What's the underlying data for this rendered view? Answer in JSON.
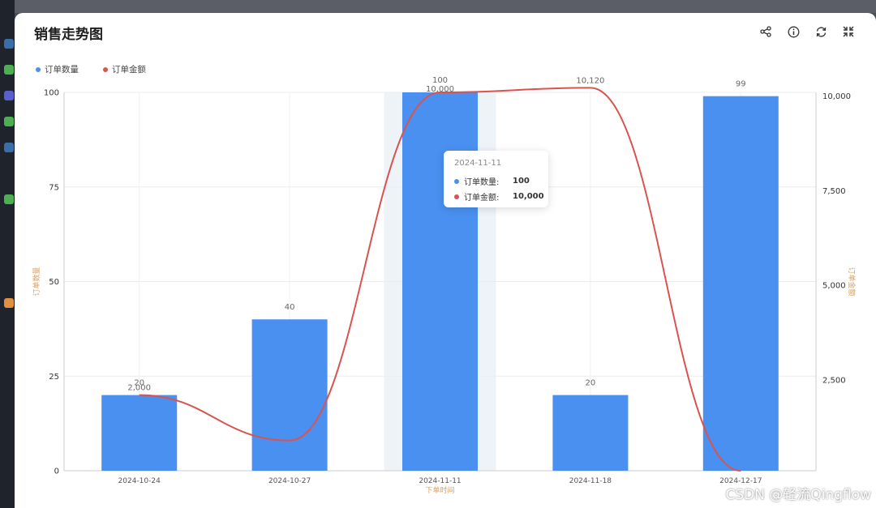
{
  "panel": {
    "title": "销售走势图"
  },
  "toolbar": [
    {
      "icon": "share-icon"
    },
    {
      "icon": "info-icon"
    },
    {
      "icon": "refresh-icon"
    },
    {
      "icon": "collapse-icon"
    }
  ],
  "colors": {
    "bar": "#4a90f0",
    "line": "#d9534f",
    "axis_title": "#e0a060",
    "highlight": "#eef3f8"
  },
  "legend": [
    {
      "label": "订单数量",
      "color": "#4a90f0"
    },
    {
      "label": "订单金额",
      "color": "#d9534f"
    }
  ],
  "chart_data": {
    "type": "bar",
    "categories": [
      "2024-10-24",
      "2024-10-27",
      "2024-11-11",
      "2024-11-18",
      "2024-12-17"
    ],
    "series": [
      {
        "name": "订单数量",
        "type": "bar",
        "axis": "left",
        "values": [
          20,
          40,
          100,
          20,
          99
        ],
        "labels": [
          "20",
          "40",
          "100",
          "20",
          "99"
        ]
      },
      {
        "name": "订单金额",
        "type": "line",
        "axis": "right",
        "values": [
          2000,
          800,
          10000,
          10120,
          0
        ],
        "labels": [
          "2,000",
          "",
          "10,000",
          "10,120",
          ""
        ]
      }
    ],
    "xlabel": "下单时间",
    "ylabel": "订单数量",
    "y2label": "订单金额",
    "ylim": [
      0,
      100
    ],
    "y2lim": [
      0,
      10000
    ],
    "yticks": [
      "0",
      "25",
      "50",
      "75",
      "100"
    ],
    "y2ticks": [
      "2,500",
      "5,000",
      "7,500",
      "10,000"
    ],
    "grid": true,
    "legend_position": "top-left",
    "highlighted_category": "2024-11-11"
  },
  "tooltip": {
    "date": "2024-11-11",
    "rows": [
      {
        "name": "订单数量:",
        "value": "100",
        "color": "#4a90f0"
      },
      {
        "name": "订单金额:",
        "value": "10,000",
        "color": "#d9534f"
      }
    ]
  },
  "watermark": "CSDN @轻流Qingflow"
}
